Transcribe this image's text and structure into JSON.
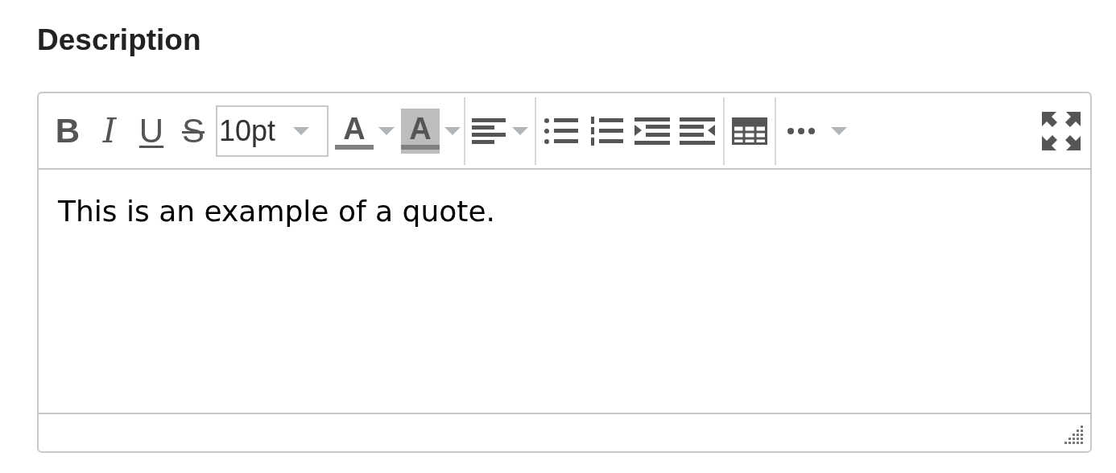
{
  "label": "Description",
  "format_buttons": [
    {
      "kind": "bold",
      "text": "B"
    },
    {
      "kind": "italic",
      "text": "I"
    },
    {
      "kind": "underline",
      "text": "U"
    },
    {
      "kind": "strike",
      "text": "S"
    }
  ],
  "font_size": "10pt",
  "color_buttons": [
    {
      "kind": "text",
      "text": "A"
    },
    {
      "kind": "background",
      "text": "A"
    }
  ],
  "content": "This is an example of a quote."
}
